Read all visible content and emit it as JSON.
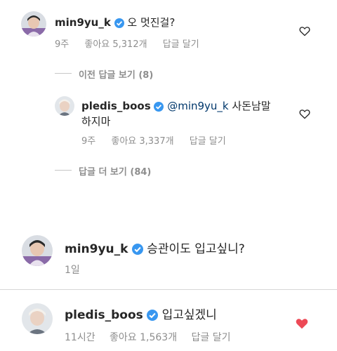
{
  "comments": [
    {
      "username": "min9yu_k",
      "text": "오 멋진걸?",
      "time": "9주",
      "likes": "좋아요 5,312개",
      "reply": "답글 달기",
      "liked": false
    },
    {
      "username": "pledis_boos",
      "mention": "@min9yu_k",
      "text_line1": "사돈남말",
      "text_line2": "하지마",
      "time": "9주",
      "likes": "좋아요 3,337개",
      "reply": "답글 달기",
      "liked": false
    },
    {
      "username": "min9yu_k",
      "text": "승관이도 입고싶니?",
      "time": "1일"
    },
    {
      "username": "pledis_boos",
      "text": "입고싶겠니",
      "time": "11시간",
      "likes": "좋아요 1,563개",
      "reply": "답글 달기",
      "liked": true
    }
  ],
  "view_previous_replies": "이전 답글 보기 (8)",
  "view_more_replies": "답글 더 보기 (84)",
  "colors": {
    "verified": "#3897f0",
    "liked_heart": "#ed4956",
    "mention": "#00376b",
    "meta": "#8e8e8e"
  },
  "icons": [
    "verified-badge-icon",
    "heart-outline-icon",
    "heart-filled-icon"
  ]
}
